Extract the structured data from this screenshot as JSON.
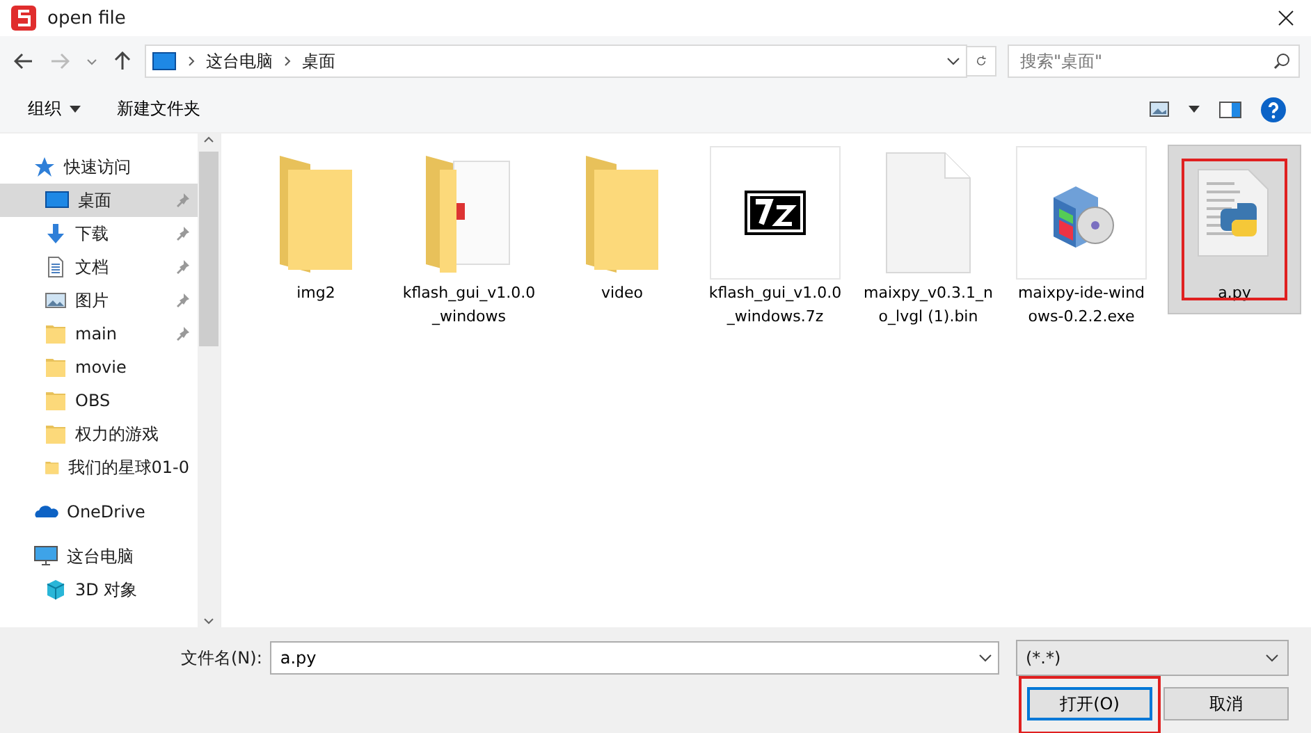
{
  "window": {
    "title": "open file"
  },
  "address": {
    "crumbs": [
      "这台电脑",
      "桌面"
    ]
  },
  "search": {
    "placeholder": "搜索\"桌面\""
  },
  "toolbar": {
    "organize": "组织",
    "new_folder": "新建文件夹"
  },
  "sidebar": {
    "items": [
      {
        "label": "快速访问",
        "kind": "star",
        "selected": false,
        "children": [
          {
            "label": "桌面",
            "kind": "desktop",
            "pinned": true,
            "selected": true
          },
          {
            "label": "下载",
            "kind": "download",
            "pinned": true,
            "selected": false
          },
          {
            "label": "文档",
            "kind": "document",
            "pinned": true,
            "selected": false
          },
          {
            "label": "图片",
            "kind": "picture",
            "pinned": true,
            "selected": false
          },
          {
            "label": "main",
            "kind": "folder",
            "pinned": true,
            "selected": false
          },
          {
            "label": "movie",
            "kind": "folder",
            "pinned": false,
            "selected": false
          },
          {
            "label": "OBS",
            "kind": "folder",
            "pinned": false,
            "selected": false
          },
          {
            "label": "权力的游戏",
            "kind": "folder",
            "pinned": false,
            "selected": false
          },
          {
            "label": "我们的星球01-0",
            "kind": "folder",
            "pinned": false,
            "selected": false
          }
        ]
      },
      {
        "label": "OneDrive",
        "kind": "cloud",
        "selected": false
      },
      {
        "label": "这台电脑",
        "kind": "pc",
        "selected": false,
        "children": [
          {
            "label": "3D 对象",
            "kind": "cube",
            "selected": false
          }
        ]
      }
    ]
  },
  "files": [
    {
      "name": "img2",
      "kind": "folder",
      "selected": false,
      "highlighted": false
    },
    {
      "name": "kflash_gui_v1.0.0_windows",
      "kind": "folder-doc",
      "selected": false,
      "highlighted": false
    },
    {
      "name": "video",
      "kind": "folder",
      "selected": false,
      "highlighted": false
    },
    {
      "name": "kflash_gui_v1.0.0_windows.7z",
      "kind": "archive",
      "selected": false,
      "highlighted": false
    },
    {
      "name": "maixpy_v0.3.1_no_lvgl (1).bin",
      "kind": "blank",
      "selected": false,
      "highlighted": false
    },
    {
      "name": "maixpy-ide-windows-0.2.2.exe",
      "kind": "installer",
      "selected": false,
      "highlighted": false
    },
    {
      "name": "a.py",
      "kind": "python",
      "selected": true,
      "highlighted": true
    }
  ],
  "footer": {
    "filename_label": "文件名(N):",
    "filename": "a.py",
    "filetype": "(*.*)",
    "buttons": [
      {
        "label": "打开(O)",
        "kind": "primary",
        "highlighted": true
      },
      {
        "label": "取消",
        "kind": "normal",
        "highlighted": false
      }
    ]
  }
}
